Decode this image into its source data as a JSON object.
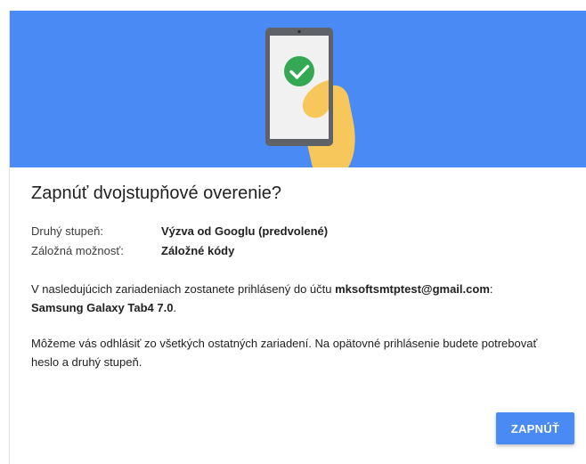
{
  "dialog": {
    "title": "Zapnúť dvojstupňové overenie?",
    "second_step_label": "Druhý stupeň:",
    "second_step_value": "Výzva od Googlu (predvolené)",
    "backup_label": "Záložná možnosť:",
    "backup_value": "Záložné kódy",
    "signed_in_text": "V nasledujúcich zariadeniach zostanete prihlásený do účtu ",
    "account_email": "mksoftsmtptest@gmail.com",
    "signed_in_colon": ":",
    "device_name": "Samsung Galaxy Tab4 7.0",
    "device_period": ".",
    "signout_text": "Môžeme vás odhlásiť zo všetkých ostatných zariadení. Na opätovné prihlásenie budete potrebovať heslo a druhý stupeň.",
    "confirm_button": "ZAPNÚŤ"
  },
  "colors": {
    "banner": "#4a8af4",
    "check": "#34a853",
    "skin": "#f8c75b",
    "device": "#5f6368",
    "button": "#4a8af4"
  }
}
